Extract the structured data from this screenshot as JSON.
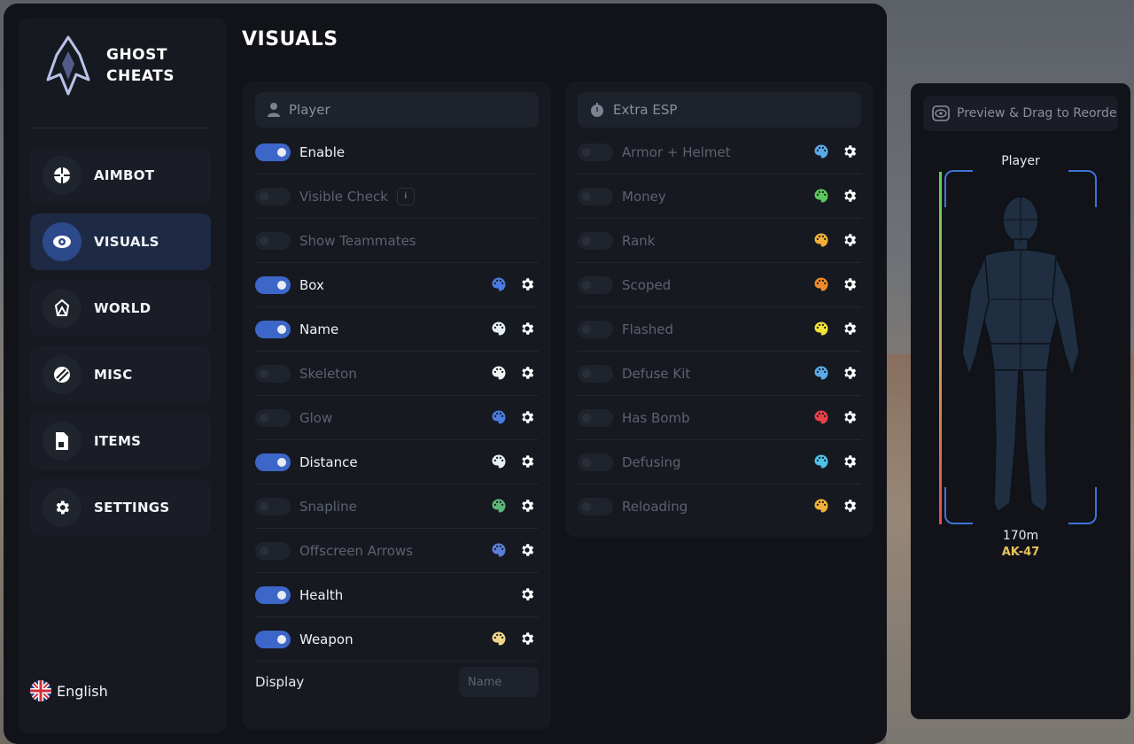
{
  "app": {
    "brand_line1": "GHOST",
    "brand_line2": "CHEATS",
    "page_title": "VISUALS"
  },
  "sidebar": {
    "items": [
      {
        "label": "AIMBOT",
        "icon": "crosshair-icon"
      },
      {
        "label": "VISUALS",
        "icon": "eye-icon",
        "active": true
      },
      {
        "label": "WORLD",
        "icon": "world-icon"
      },
      {
        "label": "MISC",
        "icon": "misc-icon"
      },
      {
        "label": "ITEMS",
        "icon": "file-icon"
      },
      {
        "label": "SETTINGS",
        "icon": "gear-icon"
      }
    ],
    "language": "English"
  },
  "player_panel": {
    "title": "Player",
    "rows": [
      {
        "label": "Enable",
        "on": true
      },
      {
        "label": "Visible Check",
        "on": false,
        "info": "i"
      },
      {
        "label": "Show Teammates",
        "on": false
      },
      {
        "label": "Box",
        "on": true,
        "color": "#4a7be0"
      },
      {
        "label": "Name",
        "on": true,
        "color": "#e6eef5"
      },
      {
        "label": "Skeleton",
        "on": false,
        "color": "#f2f2f2"
      },
      {
        "label": "Glow",
        "on": false,
        "color": "#4a7be0"
      },
      {
        "label": "Distance",
        "on": true,
        "color": "#e6eef5"
      },
      {
        "label": "Snapline",
        "on": false,
        "color": "#5bb87a"
      },
      {
        "label": "Offscreen Arrows",
        "on": false,
        "color": "#5b7fd8"
      },
      {
        "label": "Health",
        "on": true
      },
      {
        "label": "Weapon",
        "on": true,
        "color": "#f0d58a"
      }
    ],
    "display_label": "Display",
    "display_placeholder": "Name"
  },
  "extra_panel": {
    "title": "Extra ESP",
    "rows": [
      {
        "label": "Armor + Helmet",
        "on": false,
        "color": "#5aaae8"
      },
      {
        "label": "Money",
        "on": false,
        "color": "#5cc75c"
      },
      {
        "label": "Rank",
        "on": false,
        "color": "#f2b038"
      },
      {
        "label": "Scoped",
        "on": false,
        "color": "#f08a2a"
      },
      {
        "label": "Flashed",
        "on": false,
        "color": "#f2e238"
      },
      {
        "label": "Defuse Kit",
        "on": false,
        "color": "#5aaae8"
      },
      {
        "label": "Has Bomb",
        "on": false,
        "color": "#e8404a"
      },
      {
        "label": "Defusing",
        "on": false,
        "color": "#4fc0e8"
      },
      {
        "label": "Reloading",
        "on": false,
        "color": "#f2b038"
      }
    ]
  },
  "preview": {
    "header": "Preview & Drag to Reorde",
    "player_label": "Player",
    "distance": "170m",
    "weapon": "AK-47"
  }
}
